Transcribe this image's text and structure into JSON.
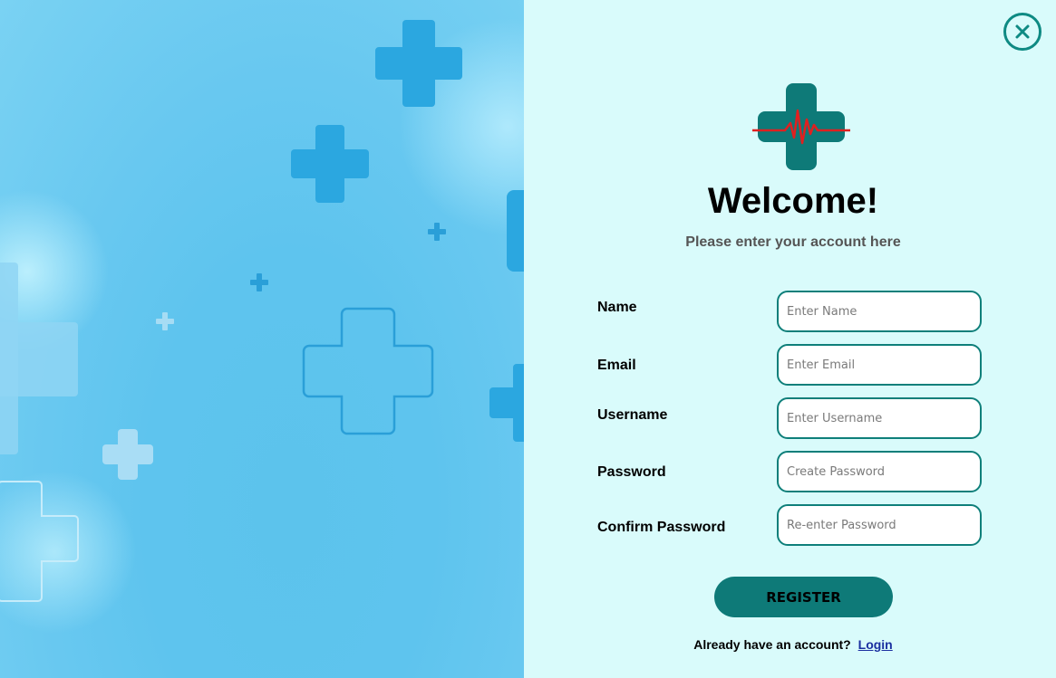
{
  "welcome": {
    "title": "Welcome!",
    "subtitle": "Please enter your account here"
  },
  "form": {
    "fields": [
      {
        "label": "Name",
        "placeholder": "Enter Name",
        "value": ""
      },
      {
        "label": "Email",
        "placeholder": "Enter Email",
        "value": ""
      },
      {
        "label": "Username",
        "placeholder": "Enter Username",
        "value": ""
      },
      {
        "label": "Password",
        "placeholder": "Create Password",
        "value": ""
      },
      {
        "label": "Confirm Password",
        "placeholder": "Re-enter Password",
        "value": ""
      }
    ],
    "register_label": "REGISTER"
  },
  "footer": {
    "prompt": "Already have an account?",
    "login_label": "Login"
  },
  "icons": {
    "close": "close-icon",
    "logo": "medical-cross-heartbeat-icon"
  },
  "colors": {
    "accent": "#0e7a78",
    "background": "#d9fbfb",
    "panel_blue": "#5ec4ee",
    "heartbeat": "#e02020"
  }
}
